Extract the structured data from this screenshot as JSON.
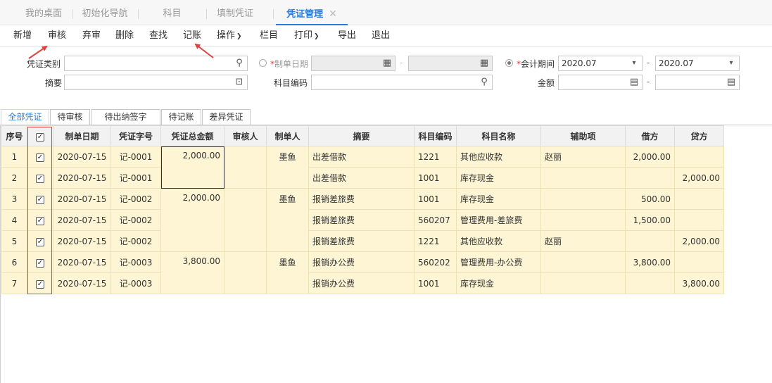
{
  "tabs": [
    {
      "label": "我的桌面"
    },
    {
      "label": "初始化导航"
    },
    {
      "label": "科目"
    },
    {
      "label": "填制凭证"
    },
    {
      "label": "凭证管理"
    }
  ],
  "toolbar": {
    "add": "新增",
    "audit": "审核",
    "abandon": "弃审",
    "delete": "删除",
    "find": "查找",
    "post": "记账",
    "operate": "操作",
    "columns": "栏目",
    "print": "打印",
    "export": "导出",
    "exit": "退出"
  },
  "filters": {
    "voucher_type_label": "凭证类别",
    "summary_label": "摘要",
    "date_label": "制单日期",
    "account_code_label": "科目编码",
    "period_label": "会计期间",
    "amount_label": "金额",
    "period_from": "2020.07",
    "period_to": "2020.07",
    "dash": "-"
  },
  "subtabs": [
    "全部凭证",
    "待审核",
    "待出纳签字",
    "待记账",
    "差异凭证"
  ],
  "table": {
    "headers": [
      "序号",
      "",
      "制单日期",
      "凭证字号",
      "凭证总金额",
      "审核人",
      "制单人",
      "摘要",
      "科目编码",
      "科目名称",
      "辅助项",
      "借方",
      "贷方"
    ],
    "rows": [
      {
        "no": "1",
        "date": "2020-07-15",
        "voucher": "记-0001",
        "total": "2,000.00",
        "auditor": "",
        "maker": "墨鱼",
        "summary": "出差借款",
        "code": "1221",
        "name": "其他应收款",
        "aux": "赵丽",
        "debit": "2,000.00",
        "credit": ""
      },
      {
        "no": "2",
        "date": "2020-07-15",
        "voucher": "记-0001",
        "total": "",
        "auditor": "",
        "maker": "",
        "summary": "出差借款",
        "code": "1001",
        "name": "库存现金",
        "aux": "",
        "debit": "",
        "credit": "2,000.00"
      },
      {
        "no": "3",
        "date": "2020-07-15",
        "voucher": "记-0002",
        "total": "2,000.00",
        "auditor": "",
        "maker": "墨鱼",
        "summary": "报销差旅费",
        "code": "1001",
        "name": "库存现金",
        "aux": "",
        "debit": "500.00",
        "credit": ""
      },
      {
        "no": "4",
        "date": "2020-07-15",
        "voucher": "记-0002",
        "total": "",
        "auditor": "",
        "maker": "",
        "summary": "报销差旅费",
        "code": "560207",
        "name": "管理费用-差旅费",
        "aux": "",
        "debit": "1,500.00",
        "credit": ""
      },
      {
        "no": "5",
        "date": "2020-07-15",
        "voucher": "记-0002",
        "total": "",
        "auditor": "",
        "maker": "",
        "summary": "报销差旅费",
        "code": "1221",
        "name": "其他应收款",
        "aux": "赵丽",
        "debit": "",
        "credit": "2,000.00"
      },
      {
        "no": "6",
        "date": "2020-07-15",
        "voucher": "记-0003",
        "total": "3,800.00",
        "auditor": "",
        "maker": "墨鱼",
        "summary": "报销办公费",
        "code": "560202",
        "name": "管理费用-办公费",
        "aux": "",
        "debit": "3,800.00",
        "credit": ""
      },
      {
        "no": "7",
        "date": "2020-07-15",
        "voucher": "记-0003",
        "total": "",
        "auditor": "",
        "maker": "",
        "summary": "报销办公费",
        "code": "1001",
        "name": "库存现金",
        "aux": "",
        "debit": "",
        "credit": "3,800.00"
      }
    ]
  },
  "colors": {
    "accent": "#2b7bd6",
    "row_bg": "#fdf5d3",
    "annotation": "#e34040"
  }
}
